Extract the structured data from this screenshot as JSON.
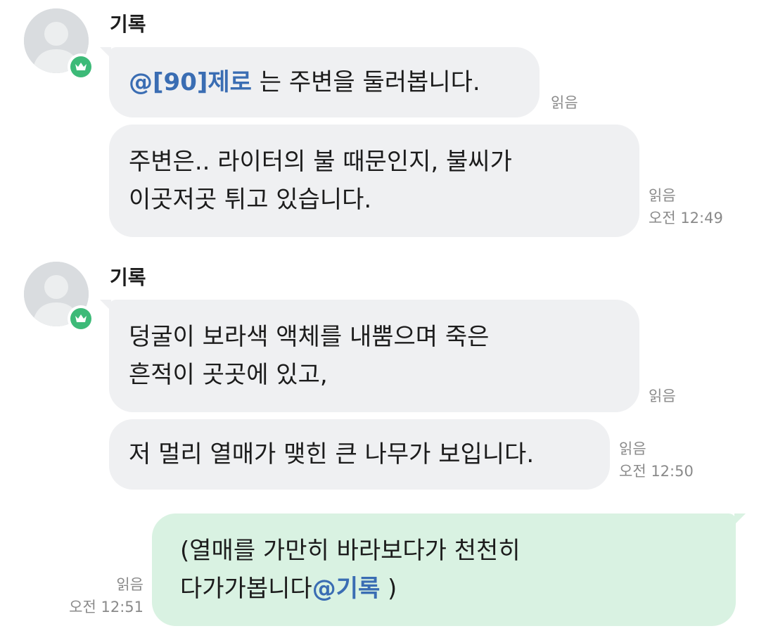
{
  "groups": [
    {
      "sender": "기록",
      "messages": [
        {
          "mention": "@[90]제로",
          "text": " 는 주변을 둘러봅니다.",
          "read": "읽음",
          "time": ""
        },
        {
          "lines": [
            "주변은.. 라이터의 불 때문인지, 불씨가",
            "이곳저곳 튀고 있습니다."
          ],
          "read": "읽음",
          "time": "오전 12:49"
        }
      ]
    },
    {
      "sender": "기록",
      "messages": [
        {
          "lines": [
            "덩굴이 보라색 액체를 내뿜으며 죽은",
            "흔적이 곳곳에 있고,"
          ],
          "read": "읽음",
          "time": ""
        },
        {
          "lines": [
            "저 멀리 열매가 맺힌 큰 나무가 보입니다."
          ],
          "read": "읽음",
          "time": "오전 12:50"
        }
      ]
    }
  ],
  "my_message": {
    "line1": "(열매를 가만히 바라보다가 천천히",
    "line2_text": "다가가봅니다",
    "line2_mention": "@기록",
    "line2_end": " )",
    "read": "읽음",
    "time": "오전 12:51"
  },
  "icons": {
    "avatar": "default-user-avatar",
    "badge": "crown-icon"
  },
  "colors": {
    "bubble_received": "#eff0f2",
    "bubble_sent": "#d9f2e2",
    "mention": "#3a6db3",
    "badge": "#3dba78",
    "meta": "#8a8a8a"
  }
}
